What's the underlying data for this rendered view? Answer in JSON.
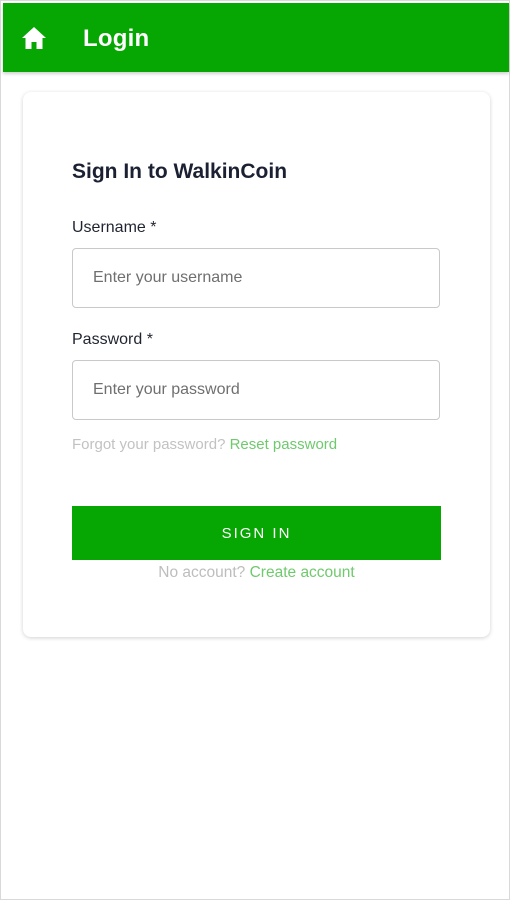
{
  "app_bar": {
    "title": "Login",
    "home_icon": "home-icon",
    "background_color": "#06a603"
  },
  "login_card": {
    "heading": "Sign In to WalkinCoin",
    "username": {
      "label": "Username *",
      "placeholder": "Enter your username",
      "value": ""
    },
    "password": {
      "label": "Password *",
      "placeholder": "Enter your password",
      "value": ""
    },
    "forgot": {
      "text": "Forgot your password?",
      "link_label": "Reset password"
    },
    "sign_in_button": {
      "label": "SIGN IN",
      "color": "#06a603"
    },
    "no_account": {
      "text": "No account?",
      "link_label": "Create account"
    },
    "link_color": "#6fc96d"
  }
}
